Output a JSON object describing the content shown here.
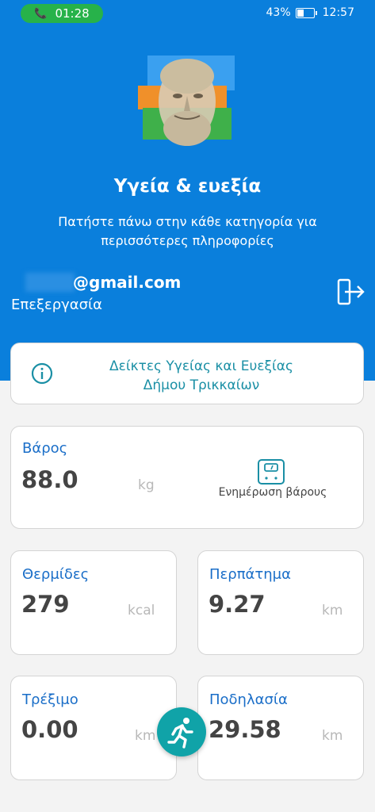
{
  "status_bar": {
    "call_time": "01:28",
    "battery_percent_label": "43%",
    "battery_level": 0.43,
    "clock": "12:57"
  },
  "header": {
    "title": "Υγεία & ευεξία",
    "subtitle": "Πατήστε πάνω στην κάθε κατηγορία για περισσότερες πληροφορίες"
  },
  "user": {
    "email": "@gmail.com",
    "edit_label": "Επεξεργασία"
  },
  "info_card": {
    "line1": "Δείκτες Υγείας και Ευεξίας",
    "line2": "Δήμου Τρικκαίων"
  },
  "weight": {
    "title": "Βάρος",
    "value": "88.0",
    "unit": "kg",
    "update_label": "Ενημέρωση βάρους"
  },
  "metrics": [
    {
      "title": "Θερμίδες",
      "value": "279",
      "unit": "kcal"
    },
    {
      "title": "Περπάτημα",
      "value": "9.27",
      "unit": "km"
    },
    {
      "title": "Τρέξιμο",
      "value": "0.00",
      "unit": "km"
    },
    {
      "title": "Ποδηλασία",
      "value": "29.58",
      "unit": "km"
    }
  ],
  "colors": {
    "primary_blue": "#0a7fdc",
    "teal_accent": "#10a3a8",
    "call_green": "#27b24a",
    "title_blue": "#1a6ec8"
  },
  "icons": {
    "call": "phone-icon",
    "info": "info-icon",
    "logout": "logout-icon",
    "scale": "scale-icon",
    "fab": "running-icon"
  }
}
